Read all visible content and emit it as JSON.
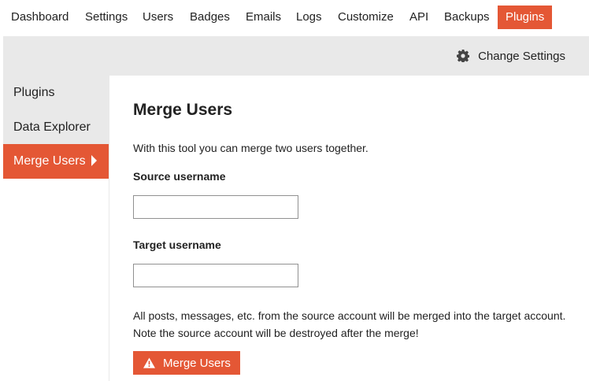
{
  "top_nav": {
    "items": [
      "Dashboard",
      "Settings",
      "Users",
      "Badges",
      "Emails",
      "Logs",
      "Customize",
      "API",
      "Backups",
      "Plugins"
    ],
    "active": "Plugins"
  },
  "sub_bar": {
    "change_settings_label": "Change Settings",
    "change_settings_icon": "gear-icon"
  },
  "sidebar": {
    "items": [
      "Plugins",
      "Data Explorer",
      "Merge Users"
    ],
    "active": "Merge Users"
  },
  "main": {
    "title": "Merge Users",
    "description": "With this tool you can merge two users together.",
    "source_label": "Source username",
    "source_value": "",
    "target_label": "Target username",
    "target_value": "",
    "warning_text": "All posts, messages, etc. from the source account will be merged into the target account. Note the source account will be destroyed after the merge!",
    "merge_button_label": "Merge Users",
    "merge_button_icon": "warning-icon"
  },
  "colors": {
    "accent": "#e45735",
    "bar_background": "#e9e9e9",
    "text": "#222222"
  }
}
